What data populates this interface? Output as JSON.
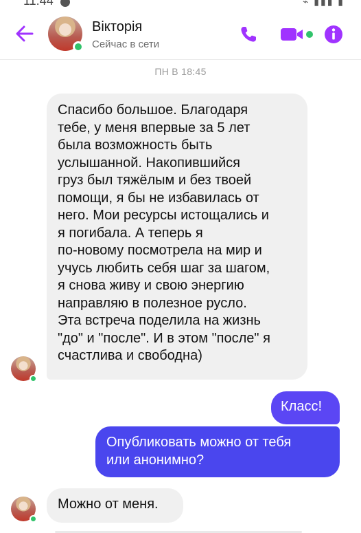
{
  "status_bar": {
    "time": "11:44"
  },
  "header": {
    "contact_name": "Вікторія",
    "contact_status": "Сейчас в сети",
    "accent_color": "#a033ff",
    "online_color": "#31c36b",
    "icons": [
      "back-arrow-icon",
      "phone-icon",
      "video-camera-icon",
      "info-icon"
    ]
  },
  "conversation": {
    "date_separator": "ПН В 18:45",
    "messages": [
      {
        "sender": "contact",
        "lines": [
          "Спасибо большое. Благодаря",
          "тебе, у меня впервые за 5 лет",
          "была возможность быть",
          "услышанной. Накопившийся",
          "груз был тяжёлым и без твоей",
          "помощи, я бы не избавилась от",
          "него. Мои ресурсы истощались и",
          "я погибала. А теперь я",
          "по-новому посмотрела на мир и",
          "учусь любить себя шаг за шагом,",
          "я снова живу и свою энергию",
          "направляю в полезное русло.",
          "Эта встреча поделила на жизнь",
          "\"до\" и \"после\". И в этом \"после\" я",
          "счастлива и свободна)"
        ]
      },
      {
        "sender": "me",
        "text": "Класс!"
      },
      {
        "sender": "me",
        "lines": [
          "Опубликовать можно от тебя",
          "или анонимно?"
        ]
      },
      {
        "sender": "contact",
        "text": "Можно от меня."
      }
    ]
  },
  "colors": {
    "incoming_bubble": "#f0f0f0",
    "outgoing_bubble": "#4c41f3"
  }
}
